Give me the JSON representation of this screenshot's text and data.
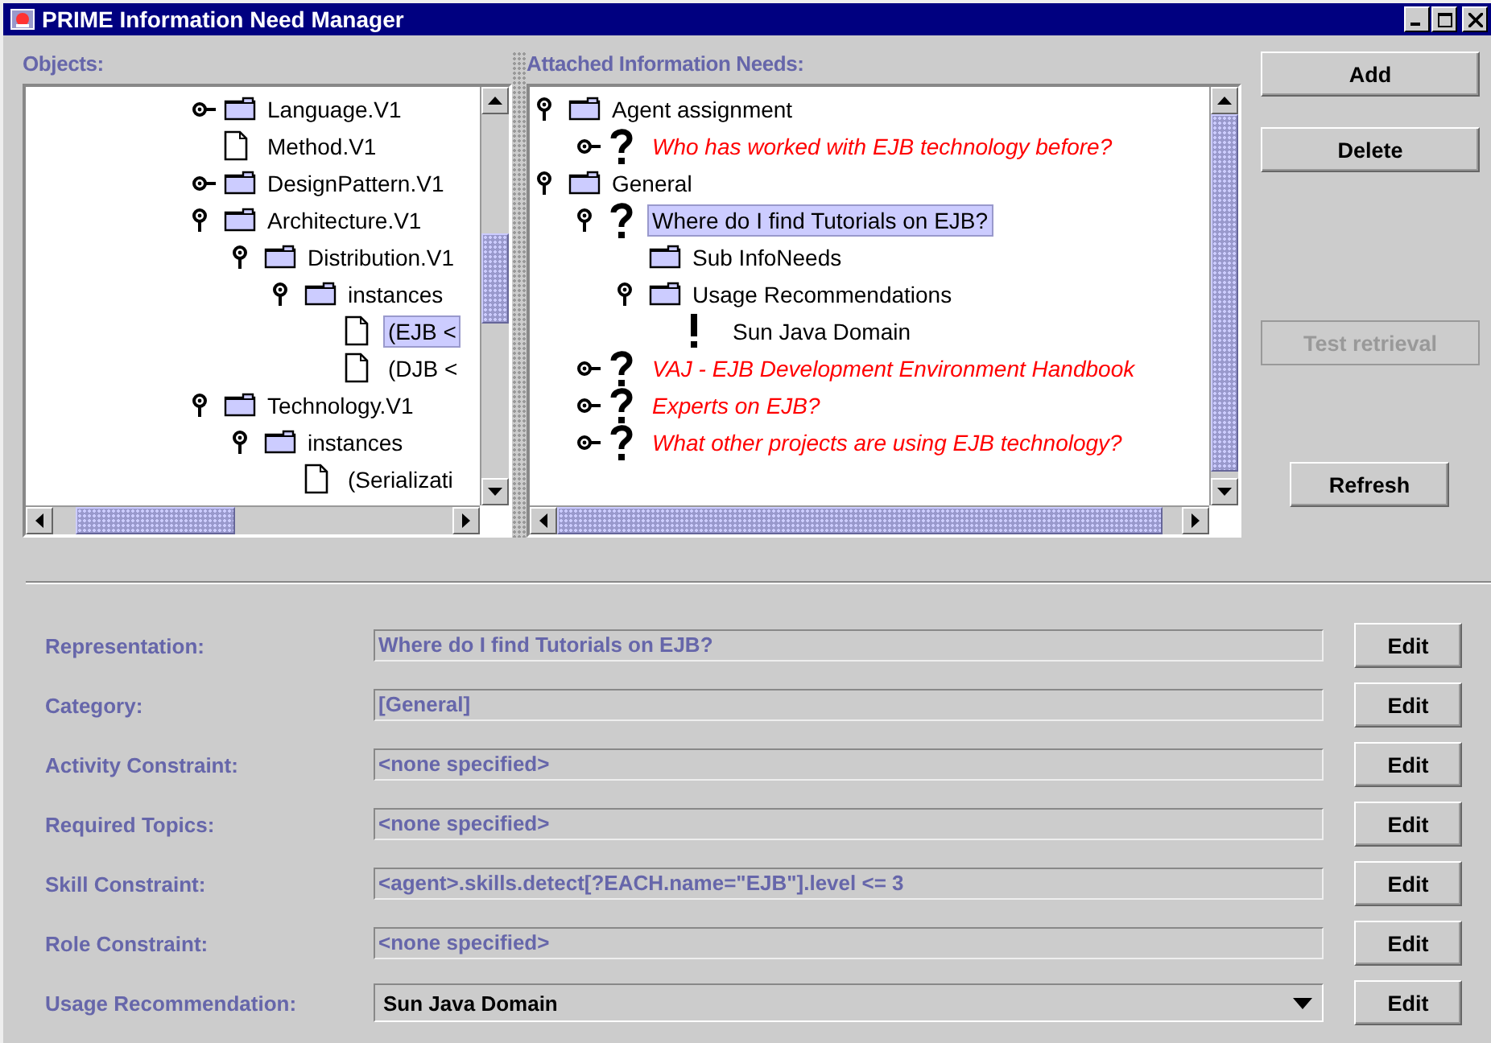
{
  "window": {
    "title": "PRIME Information Need Manager"
  },
  "objects_panel": {
    "label": "Objects:",
    "tree": [
      {
        "label": "Language.V1",
        "kind": "folder",
        "expanded": false,
        "selected": false
      },
      {
        "label": "Method.V1",
        "kind": "document",
        "selected": false
      },
      {
        "label": "DesignPattern.V1",
        "kind": "folder",
        "expanded": false,
        "selected": false
      },
      {
        "label": "Architecture.V1",
        "kind": "folder",
        "expanded": true,
        "selected": false,
        "children": [
          {
            "label": "Distribution.V1",
            "kind": "folder",
            "expanded": true,
            "selected": false,
            "children": [
              {
                "label": "instances",
                "kind": "folder",
                "expanded": true,
                "selected": false,
                "children": [
                  {
                    "label": "(EJB <",
                    "kind": "document",
                    "selected": true
                  },
                  {
                    "label": "(DJB <",
                    "kind": "document",
                    "selected": false
                  }
                ]
              }
            ]
          }
        ]
      },
      {
        "label": "Technology.V1",
        "kind": "folder",
        "expanded": true,
        "selected": false,
        "children": [
          {
            "label": "instances",
            "kind": "folder",
            "expanded": true,
            "selected": false,
            "children": [
              {
                "label": "(Serializati",
                "kind": "document",
                "selected": false
              }
            ]
          }
        ]
      }
    ]
  },
  "needs_panel": {
    "label": "Attached Information Needs:",
    "tree": [
      {
        "label": "Agent assignment",
        "kind": "folder",
        "expanded": true,
        "selected": false,
        "emphasized": false,
        "children": [
          {
            "label": "Who has worked with EJB technology before?",
            "kind": "question",
            "expanded": false,
            "selected": false,
            "emphasized": true
          }
        ]
      },
      {
        "label": "General",
        "kind": "folder",
        "expanded": true,
        "selected": false,
        "emphasized": false,
        "children": [
          {
            "label": "Where do I find Tutorials on EJB?",
            "kind": "question",
            "expanded": true,
            "selected": true,
            "emphasized": false,
            "children": [
              {
                "label": "Sub InfoNeeds",
                "kind": "folder",
                "selected": false,
                "emphasized": false
              },
              {
                "label": "Usage Recommendations",
                "kind": "folder",
                "expanded": true,
                "selected": false,
                "emphasized": false,
                "children": [
                  {
                    "label": "Sun Java Domain",
                    "kind": "recommendation",
                    "selected": false,
                    "emphasized": false
                  }
                ]
              }
            ]
          },
          {
            "label": "VAJ - EJB Development Environment Handbook",
            "kind": "question",
            "expanded": false,
            "selected": false,
            "emphasized": true
          },
          {
            "label": "Experts on EJB?",
            "kind": "question",
            "expanded": false,
            "selected": false,
            "emphasized": true
          },
          {
            "label": "What other projects are using EJB technology?",
            "kind": "question",
            "expanded": false,
            "selected": false,
            "emphasized": true
          }
        ]
      }
    ]
  },
  "actions": [
    {
      "label": "Add",
      "disabled": false
    },
    {
      "label": "Delete",
      "disabled": false
    },
    {
      "label": "Test retrieval",
      "disabled": true
    },
    {
      "label": "Refresh",
      "disabled": false
    }
  ],
  "fields": [
    {
      "label": "Representation:",
      "value": "Where do I find Tutorials on EJB?",
      "kind": "text",
      "button": "Edit"
    },
    {
      "label": "Category:",
      "value": "[General]",
      "kind": "text",
      "button": "Edit"
    },
    {
      "label": "Activity Constraint:",
      "value": "<none specified>",
      "kind": "text",
      "button": "Edit"
    },
    {
      "label": "Required Topics:",
      "value": "<none specified>",
      "kind": "text",
      "button": "Edit"
    },
    {
      "label": "Skill Constraint:",
      "value": "<agent>.skills.detect[?EACH.name=\"EJB\"].level <= 3",
      "kind": "text",
      "button": "Edit"
    },
    {
      "label": "Role Constraint:",
      "value": "<none specified>",
      "kind": "text",
      "button": "Edit"
    },
    {
      "label": "Usage Recommendation:",
      "value": "Sun Java Domain",
      "kind": "dropdown",
      "button": "Edit"
    }
  ]
}
